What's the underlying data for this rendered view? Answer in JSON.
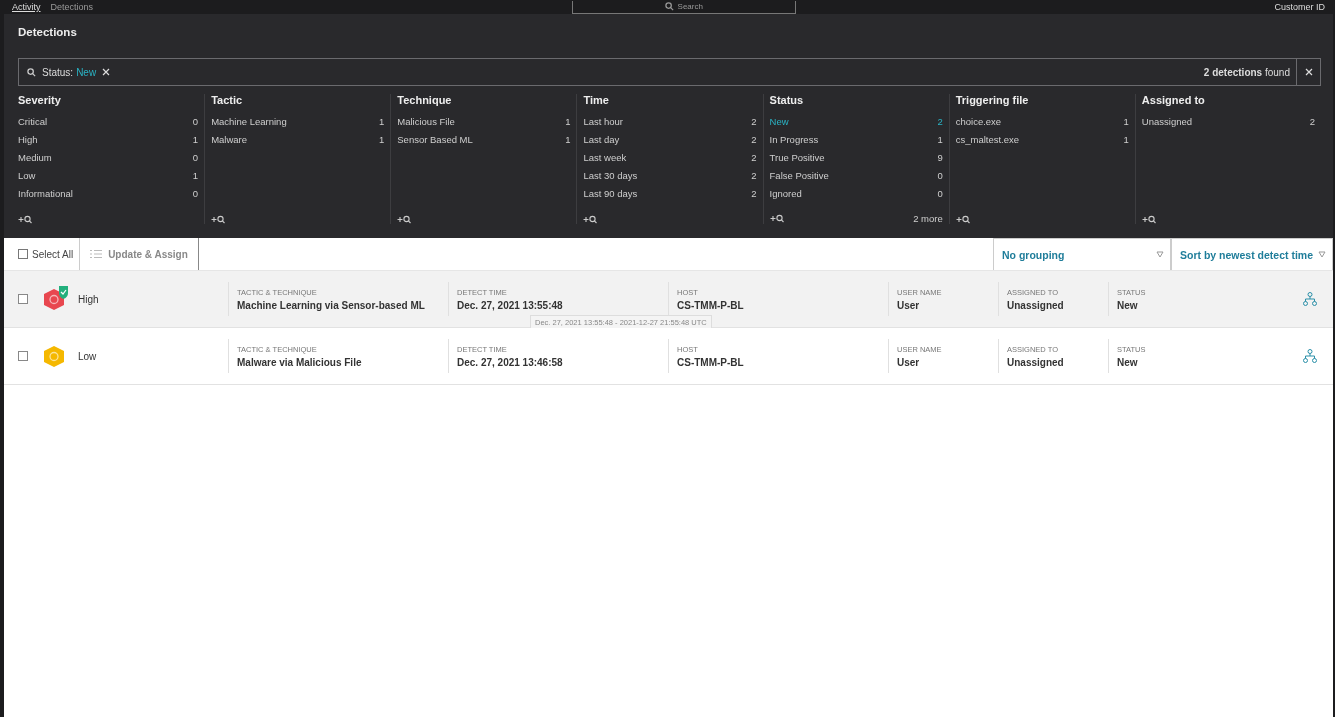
{
  "topbar": {
    "breadcrumb": [
      "Activity",
      "Detections"
    ],
    "search_placeholder": "Search",
    "account": "Customer ID"
  },
  "title": "Detections",
  "filter": {
    "label": "Status:",
    "value": "New",
    "result_count": "2 detections",
    "result_suffix": "found"
  },
  "facets": [
    {
      "title": "Severity",
      "items": [
        {
          "label": "Critical",
          "count": "0",
          "selected": false
        },
        {
          "label": "High",
          "count": "1",
          "selected": false
        },
        {
          "label": "Medium",
          "count": "0",
          "selected": false
        },
        {
          "label": "Low",
          "count": "1",
          "selected": false
        },
        {
          "label": "Informational",
          "count": "0",
          "selected": false
        }
      ]
    },
    {
      "title": "Tactic",
      "items": [
        {
          "label": "Machine Learning",
          "count": "1",
          "selected": false
        },
        {
          "label": "Malware",
          "count": "1",
          "selected": false
        }
      ]
    },
    {
      "title": "Technique",
      "items": [
        {
          "label": "Malicious File",
          "count": "1",
          "selected": false
        },
        {
          "label": "Sensor Based ML",
          "count": "1",
          "selected": false
        }
      ]
    },
    {
      "title": "Time",
      "items": [
        {
          "label": "Last hour",
          "count": "2",
          "selected": false
        },
        {
          "label": "Last day",
          "count": "2",
          "selected": false
        },
        {
          "label": "Last week",
          "count": "2",
          "selected": false
        },
        {
          "label": "Last 30 days",
          "count": "2",
          "selected": false
        },
        {
          "label": "Last 90 days",
          "count": "2",
          "selected": false
        }
      ]
    },
    {
      "title": "Status",
      "more": "2 more",
      "items": [
        {
          "label": "New",
          "count": "2",
          "selected": true
        },
        {
          "label": "In Progress",
          "count": "1",
          "selected": false
        },
        {
          "label": "True Positive",
          "count": "9",
          "selected": false
        },
        {
          "label": "False Positive",
          "count": "0",
          "selected": false
        },
        {
          "label": "Ignored",
          "count": "0",
          "selected": false
        }
      ]
    },
    {
      "title": "Triggering file",
      "items": [
        {
          "label": "choice.exe",
          "count": "1",
          "selected": false
        },
        {
          "label": "cs_maltest.exe",
          "count": "1",
          "selected": false
        }
      ]
    },
    {
      "title": "Assigned to",
      "items": [
        {
          "label": "Unassigned",
          "count": "2",
          "selected": false
        }
      ]
    }
  ],
  "toolbar": {
    "select_all": "Select All",
    "select_all_checked": false,
    "update_assign": "Update & Assign",
    "grouping": "No grouping",
    "sort": "Sort by newest detect time"
  },
  "detections": [
    {
      "severity": "High",
      "color": "#e8474f",
      "badge": true,
      "highlighted": true,
      "checked": false,
      "fields": [
        {
          "label": "TACTIC & TECHNIQUE",
          "value": "Machine Learning via Sensor-based ML"
        },
        {
          "label": "DETECT TIME",
          "value": "Dec. 27, 2021 13:55:48"
        },
        {
          "label": "HOST",
          "value": "CS-TMM-P-BL"
        },
        {
          "label": "USER NAME",
          "value": "User"
        },
        {
          "label": "ASSIGNED TO",
          "value": "Unassigned"
        },
        {
          "label": "STATUS",
          "value": "New"
        }
      ],
      "tooltip": "Dec. 27, 2021 13:55:48  - 2021-12-27 21:55:48 UTC"
    },
    {
      "severity": "Low",
      "color": "#f5b800",
      "badge": false,
      "highlighted": false,
      "checked": false,
      "fields": [
        {
          "label": "TACTIC & TECHNIQUE",
          "value": "Malware via Malicious File"
        },
        {
          "label": "DETECT TIME",
          "value": "Dec. 27, 2021 13:46:58"
        },
        {
          "label": "HOST",
          "value": "CS-TMM-P-BL"
        },
        {
          "label": "USER NAME",
          "value": "User"
        },
        {
          "label": "ASSIGNED TO",
          "value": "Unassigned"
        },
        {
          "label": "STATUS",
          "value": "New"
        }
      ]
    }
  ]
}
